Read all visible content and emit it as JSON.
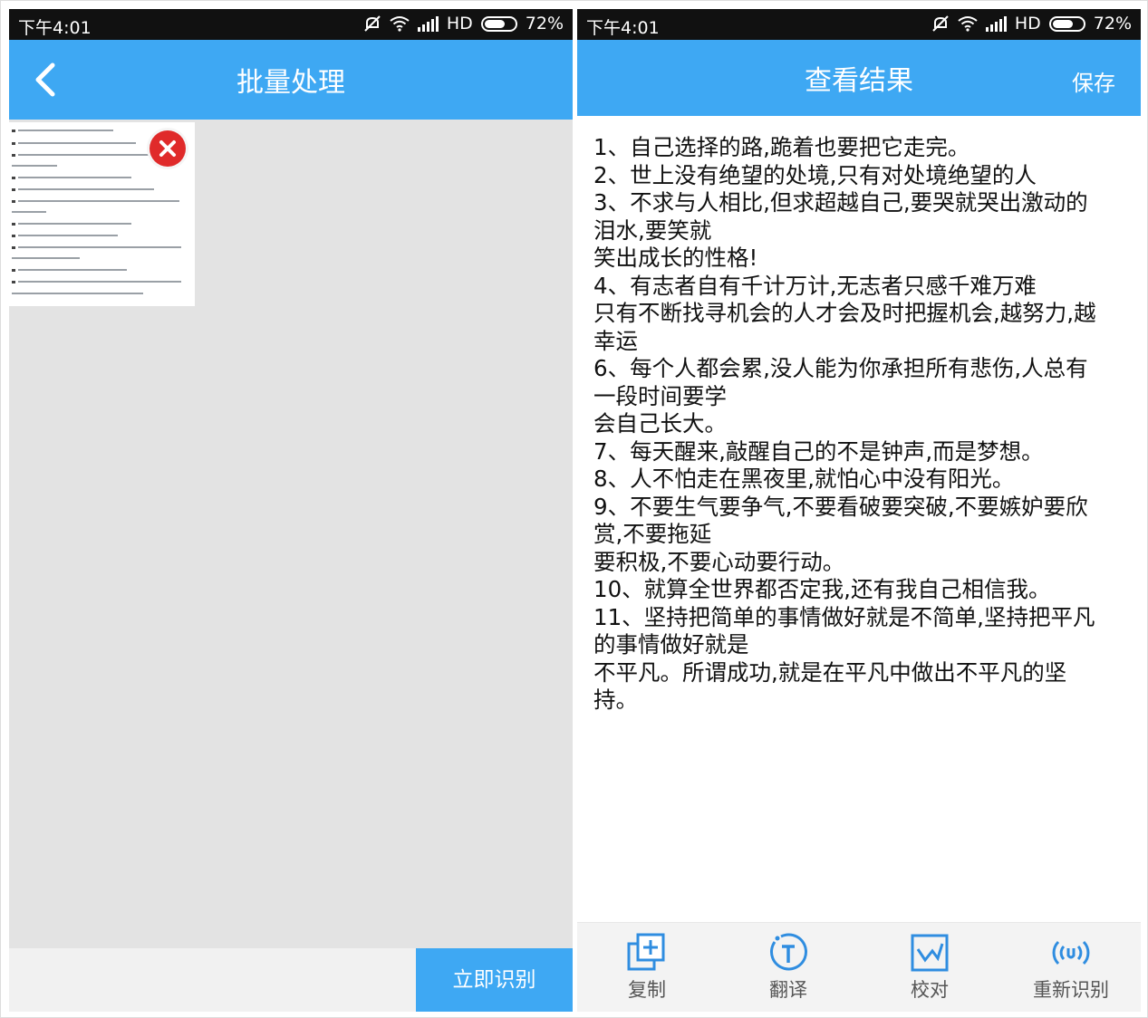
{
  "left": {
    "status": {
      "time": "下午4:01",
      "network": "HD",
      "battery": "72%"
    },
    "header": {
      "title": "批量处理"
    },
    "recognize_label": "立即识别"
  },
  "right": {
    "status": {
      "time": "下午4:01",
      "network": "HD",
      "battery": "72%"
    },
    "header": {
      "title": "查看结果",
      "save_label": "保存"
    },
    "text_lines": [
      "1、自己选择的路,跪着也要把它走完。",
      "2、世上没有绝望的处境,只有对处境绝望的人",
      "3、不求与人相比,但求超越自己,要哭就哭出激动的",
      "泪水,要笑就",
      "笑出成长的性格!",
      "4、有志者自有千计万计,无志者只感千难万难",
      "只有不断找寻机会的人才会及时把握机会,越努力,越",
      "幸运",
      "6、每个人都会累,没人能为你承担所有悲伤,人总有",
      "一段时间要学",
      "会自己长大。",
      "7、每天醒来,敲醒自己的不是钟声,而是梦想。",
      "8、人不怕走在黑夜里,就怕心中没有阳光。",
      "9、不要生气要争气,不要看破要突破,不要嫉妒要欣",
      "赏,不要拖延",
      "要积极,不要心动要行动。",
      "10、就算全世界都否定我,还有我自己相信我。",
      "11、坚持把简单的事情做好就是不简单,坚持把平凡",
      "的事情做好就是",
      "不平凡。所谓成功,就是在平凡中做出不平凡的坚",
      "持。"
    ],
    "toolbar": {
      "copy": "复制",
      "translate": "翻译",
      "proofread": "校对",
      "re_recognize": "重新识别"
    }
  },
  "colors": {
    "accent": "#3ea8f3",
    "delete": "#e02a2a"
  },
  "icons": [
    "back-arrow-icon",
    "delete-icon",
    "copy-icon",
    "translate-icon",
    "proofread-icon",
    "re-recognize-icon",
    "wifi-icon",
    "signal-icon",
    "battery-icon",
    "mute-icon"
  ]
}
